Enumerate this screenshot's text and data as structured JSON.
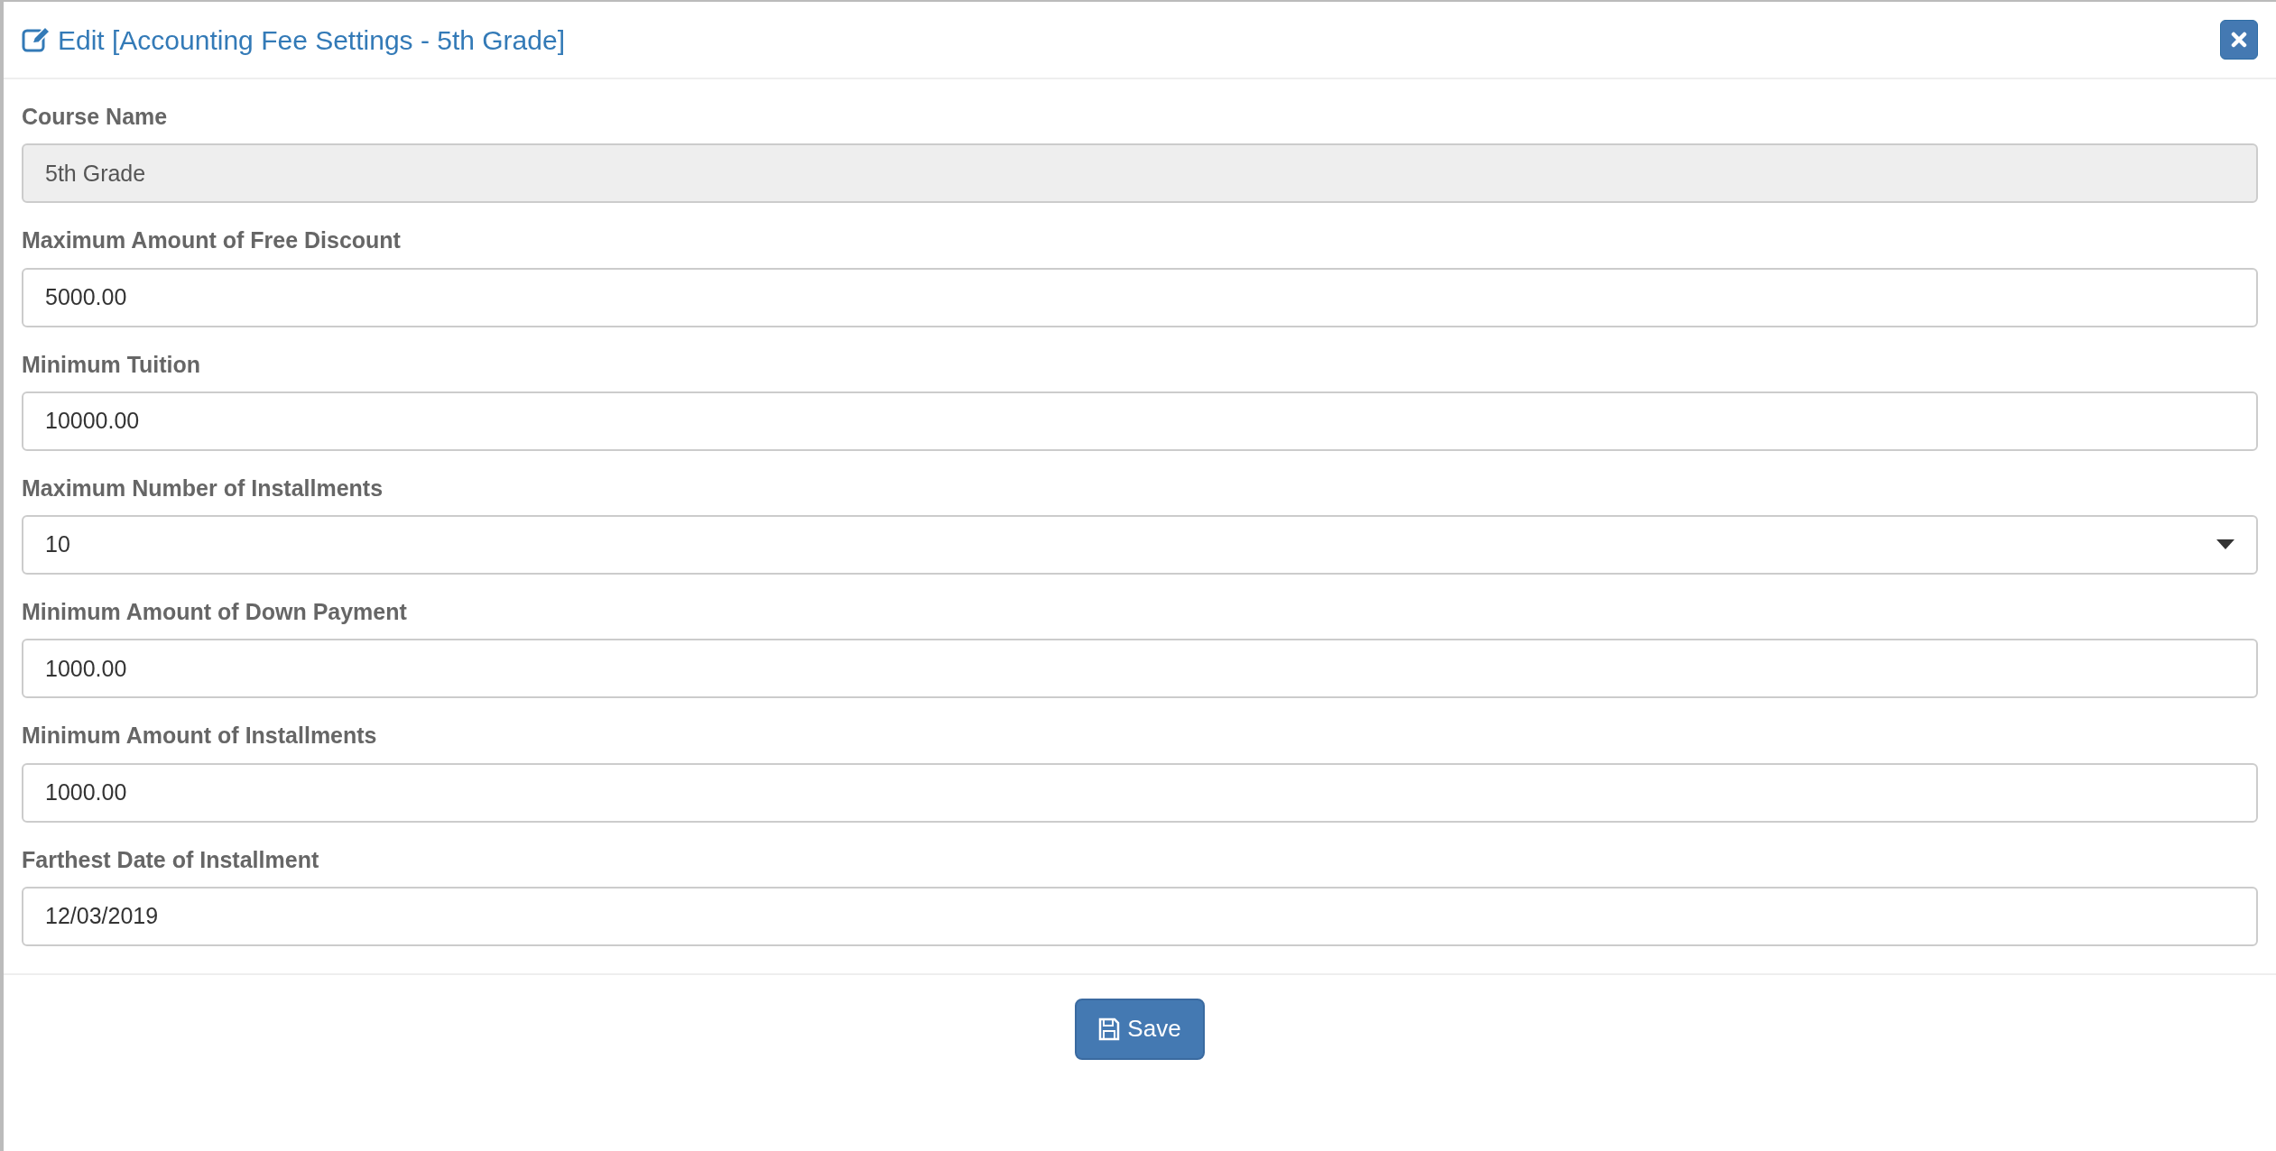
{
  "dialog": {
    "title": "Edit [Accounting Fee Settings - 5th Grade]"
  },
  "fields": [
    {
      "label": "Course Name",
      "kind": "text",
      "value": "5th Grade",
      "disabled": true
    },
    {
      "label": "Maximum Amount of Free Discount",
      "kind": "text",
      "value": "5000.00",
      "disabled": false
    },
    {
      "label": "Minimum Tuition",
      "kind": "text",
      "value": "10000.00",
      "disabled": false
    },
    {
      "label": "Maximum Number of Installments",
      "kind": "select",
      "value": "10",
      "disabled": false
    },
    {
      "label": "Minimum Amount of Down Payment",
      "kind": "text",
      "value": "1000.00",
      "disabled": false
    },
    {
      "label": "Minimum Amount of Installments",
      "kind": "text",
      "value": "1000.00",
      "disabled": false
    },
    {
      "label": "Farthest Date of Installment",
      "kind": "text",
      "value": "12/03/2019",
      "disabled": false
    }
  ],
  "buttons": [
    "Save"
  ]
}
